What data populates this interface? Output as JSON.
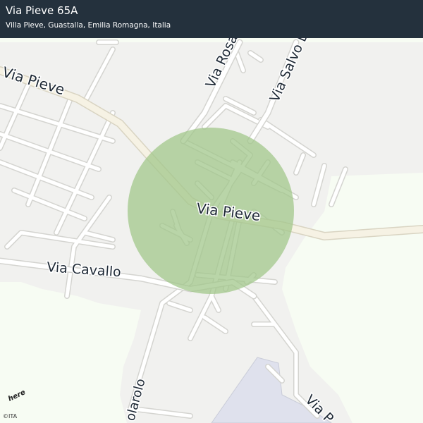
{
  "header": {
    "title": "Via Pieve 65A",
    "subtitle": "Villa Pieve, Guastalla, Emilia Romagna, Italia"
  },
  "map": {
    "road_labels": {
      "via_pieve_west": "Via   Pieve",
      "via_pieve_east": "Via   Pieve",
      "via_rosario": "Via Rosario",
      "via_salvo": "Via  Salvo  D'Acq",
      "via_cavallo": "Via   Cavallo",
      "polarolo": "olarolo",
      "bottom_right": "Via   P"
    },
    "colors": {
      "land": "#f7fcf3",
      "built_area": "#f1f1ef",
      "road": "#ffffff",
      "major_road": "#f6f2e4",
      "road_casing": "#d4d4d0",
      "circle_fill": "#a2c78b",
      "industrial": "#dfe1ed",
      "header_bg": "#24313d"
    }
  },
  "brand": {
    "logo": "here",
    "copyright": "©ITA"
  }
}
